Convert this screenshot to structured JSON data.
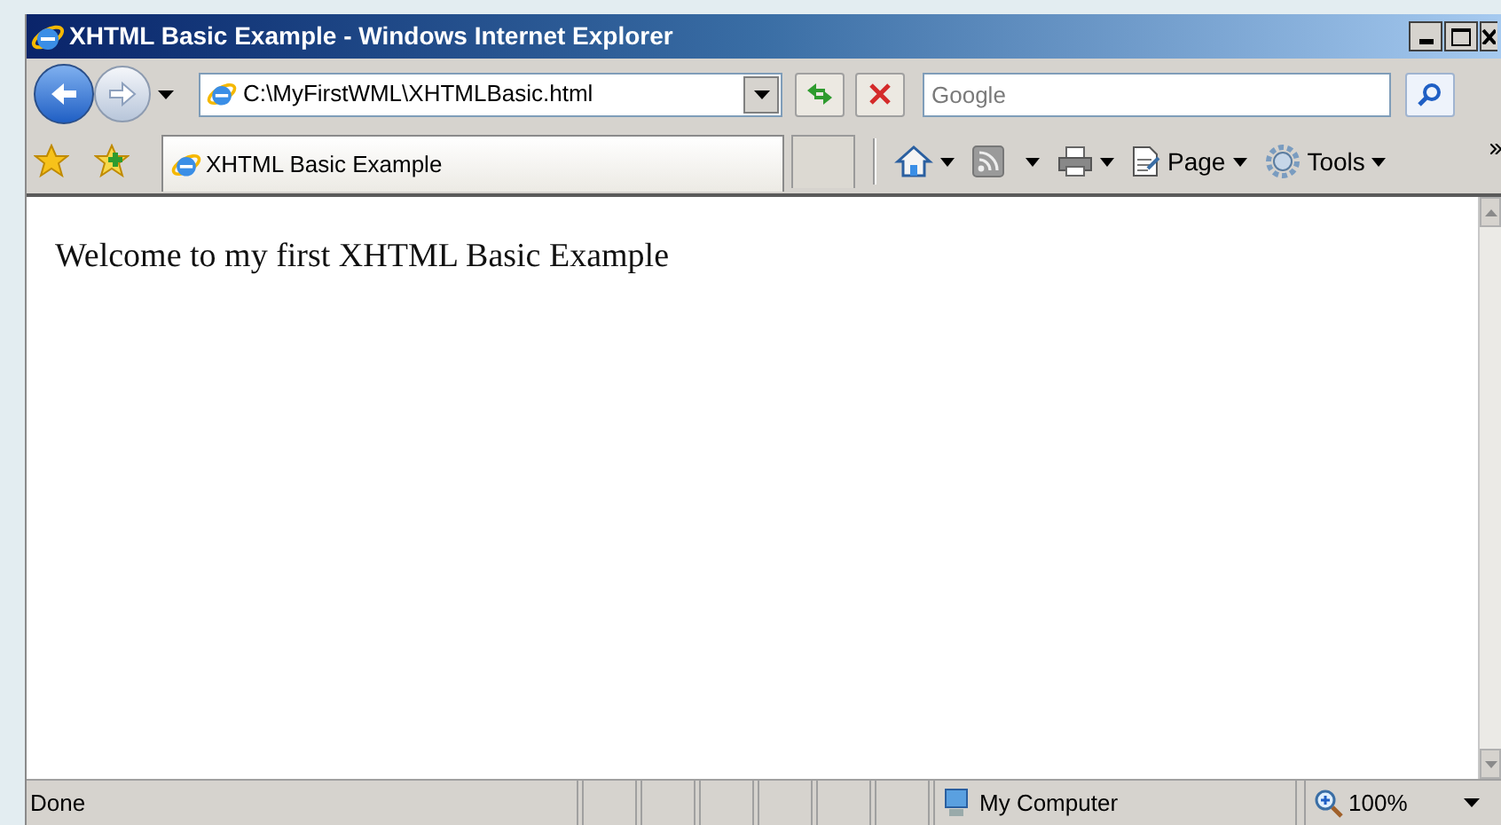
{
  "window": {
    "title": "XHTML Basic Example - Windows Internet Explorer"
  },
  "address": {
    "value": "C:\\MyFirstWML\\XHTMLBasic.html"
  },
  "search": {
    "placeholder": "Google"
  },
  "tabs": [
    {
      "label": "XHTML Basic Example",
      "selected": true
    }
  ],
  "command_bar": [
    {
      "kind": "home"
    },
    {
      "kind": "feeds"
    },
    {
      "kind": "print"
    },
    {
      "kind": "page",
      "label": "Page"
    },
    {
      "kind": "tools",
      "label": "Tools"
    }
  ],
  "content": {
    "text": "Welcome to my first XHTML Basic Example"
  },
  "status_bar": {
    "text": "Done",
    "zone": "My Computer",
    "zoom": "100%"
  }
}
